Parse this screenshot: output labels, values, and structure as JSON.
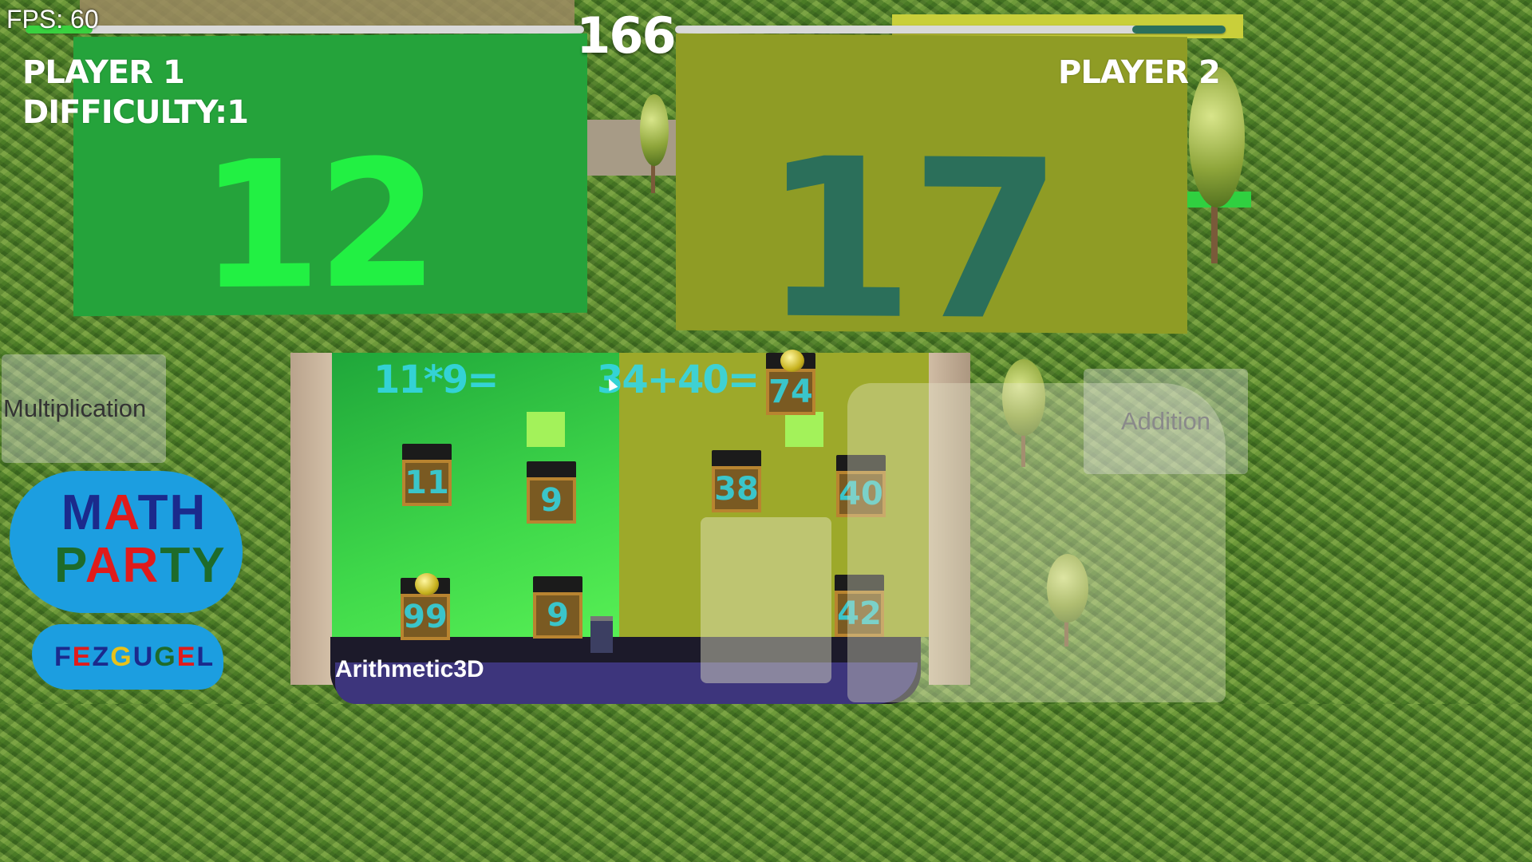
{
  "hud": {
    "fps": "FPS: 60",
    "timer": "166",
    "player1_progress": 0.12,
    "player2_progress": 0.17
  },
  "player1": {
    "name": "PLAYER 1",
    "difficulty": "DIFFICULTY:1",
    "score": "12",
    "board_color": "#25a33b",
    "score_color": "#22f043"
  },
  "player2": {
    "name": "PLAYER 2",
    "score": "17",
    "board_color": "#8f9c25",
    "score_color": "#2b6f5a"
  },
  "arena": {
    "equation_left": "11*9=",
    "equation_right": "34+40=",
    "left_boxes": [
      "11",
      "9",
      "99",
      "9"
    ],
    "right_boxes": [
      "74",
      "38",
      "40",
      "42"
    ]
  },
  "buttons": {
    "left_mode": "Multiplication",
    "right_mode": "Addition"
  },
  "logo": {
    "line1": [
      "M",
      "A",
      "T",
      "H"
    ],
    "line1_colors": [
      "#1b2a8c",
      "#e01b1b",
      "#1b2a8c",
      "#1b2a8c"
    ],
    "line2": [
      "P",
      "A",
      "R",
      "T",
      "Y"
    ],
    "line2_colors": [
      "#1e6b2a",
      "#e01b1b",
      "#e01b1b",
      "#1e6b2a",
      "#1e6b2a"
    ],
    "brand": [
      "F",
      "E",
      "Z",
      "G",
      "U",
      "G",
      "E",
      "L"
    ],
    "brand_colors": [
      "#1b2a8c",
      "#e01b1b",
      "#1b2a8c",
      "#e8c21a",
      "#1b2a8c",
      "#1e6b2a",
      "#e01b1b",
      "#1b2a8c"
    ]
  },
  "app_name": "Arithmetic3D",
  "icons": [
    "mouse-cursor-icon"
  ]
}
